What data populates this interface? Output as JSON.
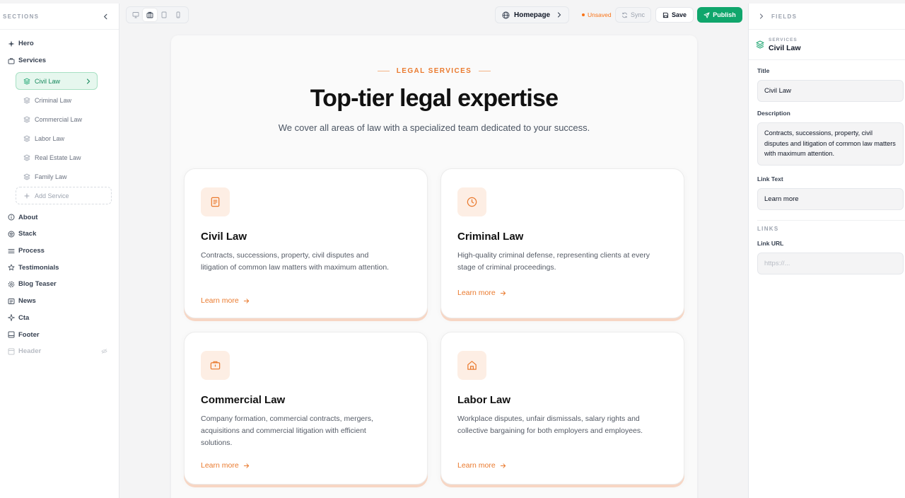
{
  "sidebar": {
    "header": "SECTIONS",
    "sections": [
      {
        "label": "Hero",
        "icon": "sparkle-icon"
      },
      {
        "label": "Services",
        "icon": "briefcase-icon"
      }
    ],
    "services_items": [
      {
        "label": "Civil Law",
        "active": true
      },
      {
        "label": "Criminal Law"
      },
      {
        "label": "Commercial Law"
      },
      {
        "label": "Labor Law"
      },
      {
        "label": "Real Estate Law"
      },
      {
        "label": "Family Law"
      }
    ],
    "add_service": "Add Service",
    "sections_after": [
      {
        "label": "About",
        "icon": "info-icon"
      },
      {
        "label": "Stack",
        "icon": "layers-icon"
      },
      {
        "label": "Process",
        "icon": "list-icon"
      },
      {
        "label": "Testimonials",
        "icon": "star-icon"
      },
      {
        "label": "Blog Teaser",
        "icon": "gear-icon"
      },
      {
        "label": "News",
        "icon": "newspaper-icon"
      },
      {
        "label": "Cta",
        "icon": "sparkle-icon"
      },
      {
        "label": "Footer",
        "icon": "layout-icon"
      },
      {
        "label": "Header",
        "icon": "layout-icon",
        "hidden": true
      }
    ]
  },
  "toolbar": {
    "page_selector": "Homepage",
    "status": "Unsaved",
    "sync_label": "Sync",
    "save_label": "Save",
    "publish_label": "Publish"
  },
  "canvas": {
    "eyebrow": "LEGAL SERVICES",
    "headline": "Top-tier legal expertise",
    "subheadline": "We cover all areas of law with a specialized team dedicated to your success.",
    "cards": [
      {
        "title": "Civil Law",
        "description": "Contracts, successions, property, civil disputes and litigation of common law matters with maximum attention.",
        "link": "Learn more",
        "icon": "document-icon"
      },
      {
        "title": "Criminal Law",
        "description": "High-quality criminal defense, representing clients at every stage of criminal proceedings.",
        "link": "Learn more",
        "icon": "clock-icon"
      },
      {
        "title": "Commercial Law",
        "description": "Company formation, commercial contracts, mergers, acquisitions and commercial litigation with efficient solutions.",
        "link": "Learn more",
        "icon": "briefcase-icon"
      },
      {
        "title": "Labor Law",
        "description": "Workplace disputes, unfair dismissals, salary rights and collective bargaining for both employers and employees.",
        "link": "Learn more",
        "icon": "home-icon"
      }
    ]
  },
  "fields_panel": {
    "header": "FIELDS",
    "crumb_parent": "SERVICES",
    "crumb_title": "Civil Law",
    "title_label": "Title",
    "title_value": "Civil Law",
    "description_label": "Description",
    "description_value": "Contracts, successions, property, civil disputes and litigation of common law matters with maximum attention.",
    "link_text_label": "Link Text",
    "link_text_value": "Learn more",
    "links_group": "LINKS",
    "link_url_label": "Link URL",
    "link_url_placeholder": "https://..."
  },
  "colors": {
    "accent_green": "#10a66c",
    "accent_orange": "#ea7a2e",
    "unsaved": "#f97316"
  }
}
